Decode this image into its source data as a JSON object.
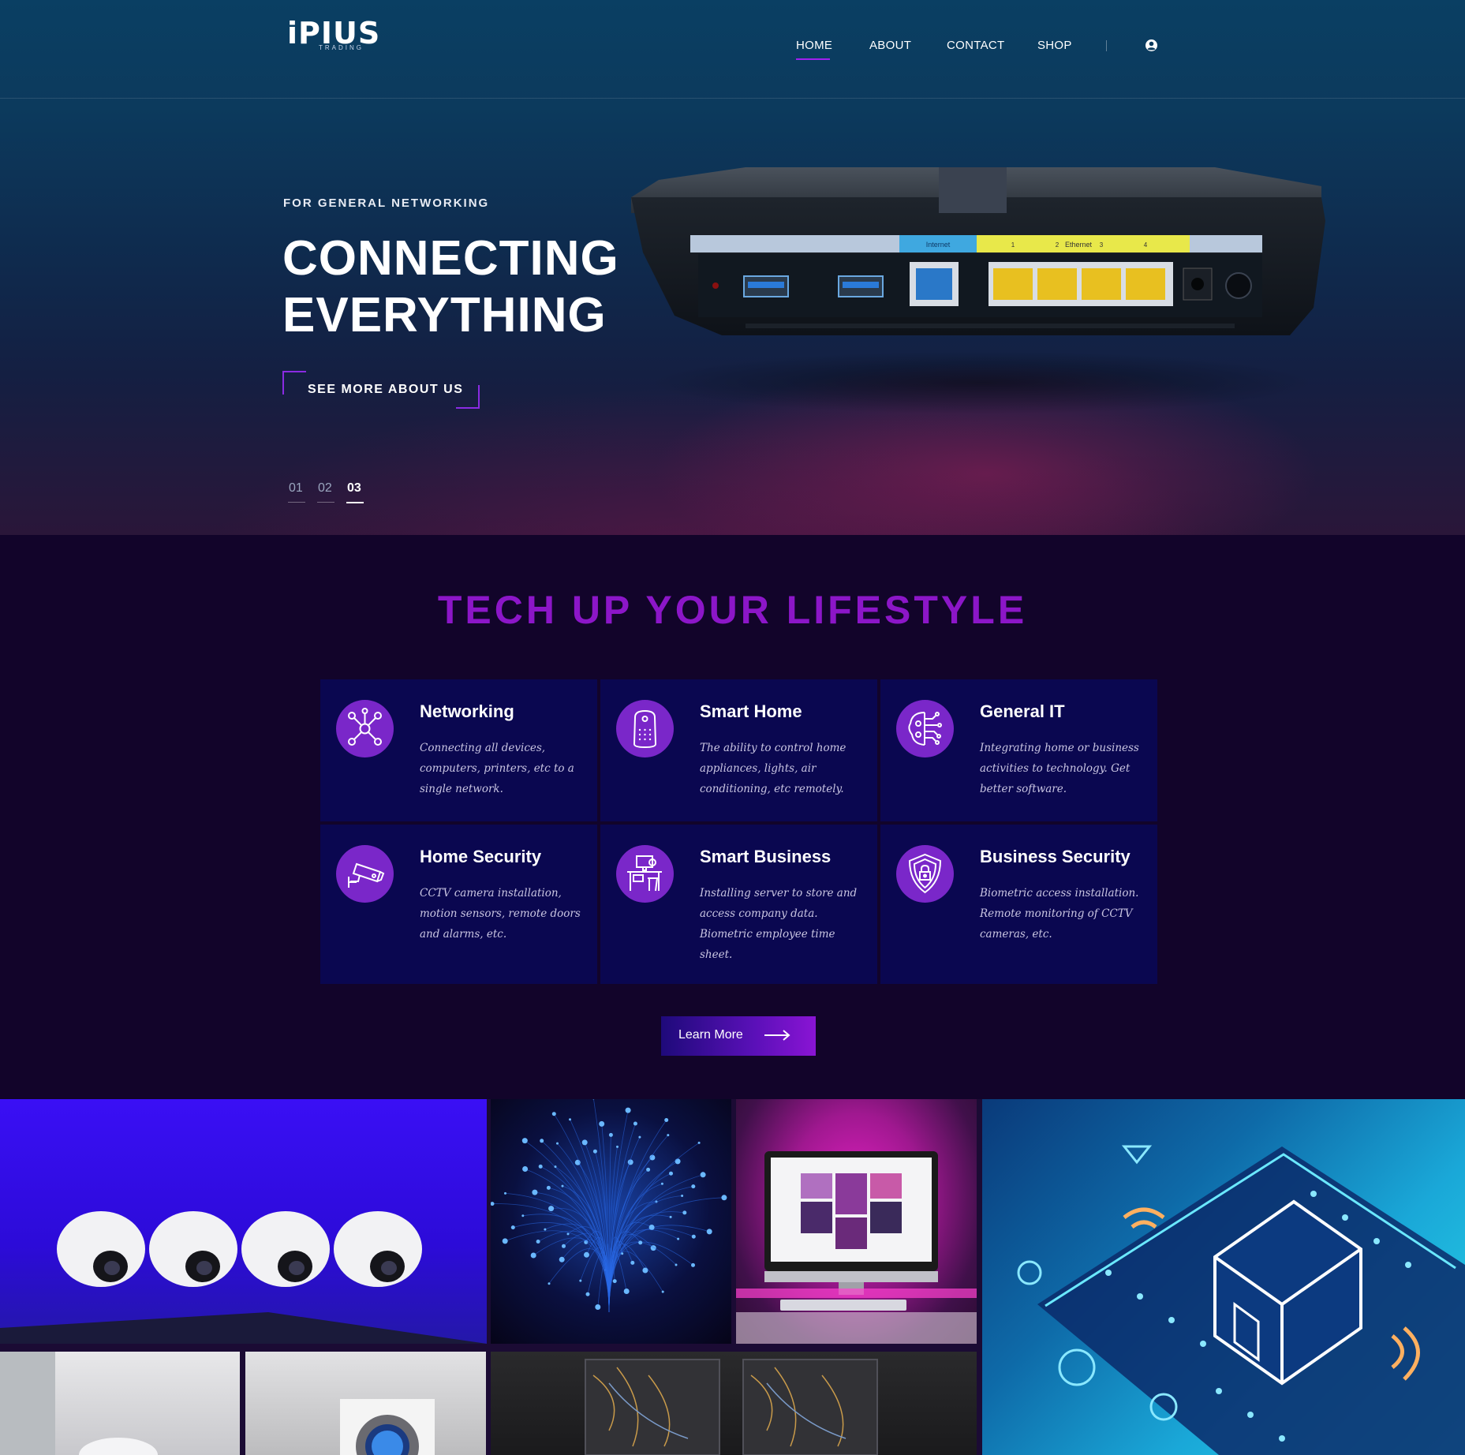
{
  "brand": {
    "logo_text": "iPIUS",
    "logo_sub": "TRADING"
  },
  "nav": {
    "items": [
      {
        "label": "HOME"
      },
      {
        "label": "ABOUT"
      },
      {
        "label": "CONTACT"
      },
      {
        "label": "SHOP"
      }
    ],
    "active": "HOME",
    "user_icon": "user-circle-icon"
  },
  "hero": {
    "eyebrow": "FOR GENERAL NETWORKING",
    "headline_line1": "CONNECTING",
    "headline_line2": "EVERYTHING",
    "cta_label": "SEE MORE ABOUT US",
    "slides": [
      "01",
      "02",
      "03"
    ],
    "active_slide": "03",
    "router_port_labels": {
      "internet": "Internet",
      "ethernet": "Ethernet",
      "ports": [
        "1",
        "2",
        "3",
        "4"
      ]
    }
  },
  "features": {
    "title": "TECH UP YOUR LIFESTYLE",
    "cards": [
      {
        "title": "Networking",
        "desc": "Connecting all devices, computers, printers, etc to a single network.",
        "icon": "network-nodes-icon"
      },
      {
        "title": "Smart Home",
        "desc": "The ability to control home appliances, lights, air conditioning, etc remotely.",
        "icon": "smart-speaker-icon"
      },
      {
        "title": "General IT",
        "desc": "Integrating home or business activities to technology. Get better software.",
        "icon": "circuit-brain-icon"
      },
      {
        "title": "Home Security",
        "desc": "CCTV camera installation, motion sensors, remote doors and alarms, etc.",
        "icon": "cctv-camera-icon"
      },
      {
        "title": "Smart Business",
        "desc": "Installing server to store and access company data. Biometric employee time sheet.",
        "icon": "office-desk-icon"
      },
      {
        "title": "Business Security",
        "desc": "Biometric access installation. Remote monitoring of CCTV cameras, etc.",
        "icon": "shield-lock-icon"
      }
    ],
    "learn_more_label": "Learn More"
  },
  "gallery": {
    "tiles": [
      "cctv-cameras-image",
      "fiber-optics-image",
      "desktop-computer-image",
      "smart-home-image",
      "smart-speaker-image",
      "thermostat-image",
      "server-rack-image"
    ]
  },
  "colors": {
    "accent_purple": "#8c16c8",
    "card_bg": "#0a0750",
    "page_bg": "#12042a",
    "icon_circle": "#7a27c9"
  }
}
